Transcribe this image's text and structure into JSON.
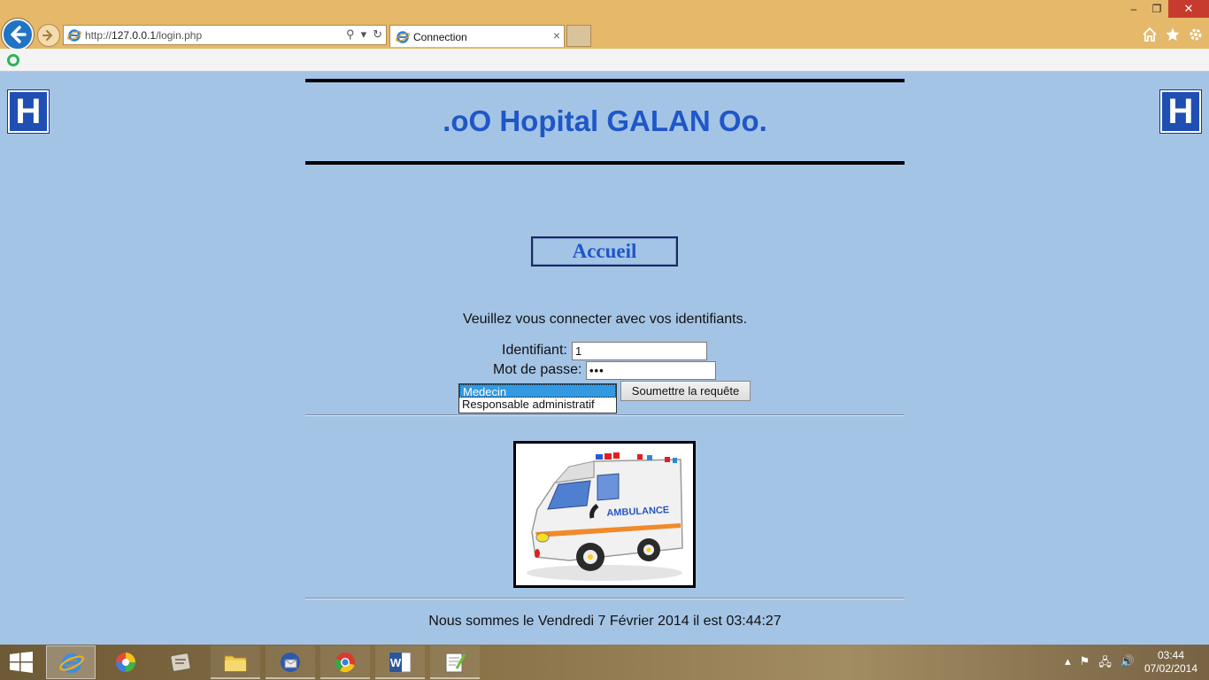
{
  "browser": {
    "url_prefix": "http://",
    "url_host": "127.0.0.1",
    "url_path": "/login.php",
    "tab_title": "Connection",
    "tab_close": "×",
    "window_controls": {
      "minimize": "–",
      "restore": "❐",
      "close": "✕"
    },
    "toolbar_icons": [
      "home-icon",
      "favorites-star-icon",
      "settings-gear-icon"
    ]
  },
  "page": {
    "logo_letter": "H",
    "site_title": ".oO Hopital GALAN Oo.",
    "nav_button": "Accueil",
    "instruction": "Veuillez vous connecter avec vos identifiants.",
    "login_label": "Identifiant:",
    "login_value": "1",
    "password_label": "Mot de passe:",
    "password_value": "•••",
    "role_options": [
      "Medecin",
      "Responsable administratif"
    ],
    "submit_label": "Soumettre la requête",
    "ambulance_label": "AMBULANCE",
    "date_text": "Nous sommes le Vendredi 7 Février 2014 il est 03:44:27"
  },
  "taskbar": {
    "apps": [
      "internet-explorer",
      "picasa",
      "scanner",
      "file-explorer",
      "thunderbird",
      "chrome",
      "word",
      "notepad-plus"
    ],
    "time": "03:44",
    "date": "07/02/2014"
  },
  "colors": {
    "page_bg": "#a4c4e6",
    "title_blue": "#1f57c7",
    "logo_blue": "#1f4fb3",
    "chrome_bg": "#e5b86a",
    "selected_option": "#3399e0"
  }
}
